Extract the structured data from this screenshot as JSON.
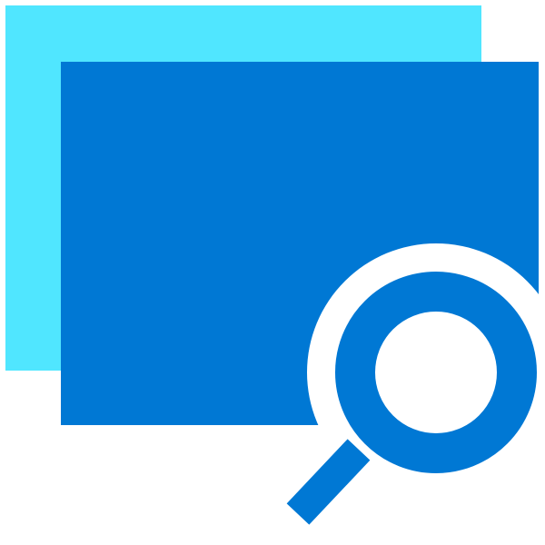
{
  "icon": {
    "semantic": "window-search-icon",
    "parts": [
      "back-window",
      "front-window",
      "magnifier"
    ]
  },
  "colors": {
    "background": "#ffffff",
    "back_window": "#50e6ff",
    "front_window": "#0078d4",
    "magnifier": "#0078d4",
    "magnifier_halo": "#ffffff"
  }
}
